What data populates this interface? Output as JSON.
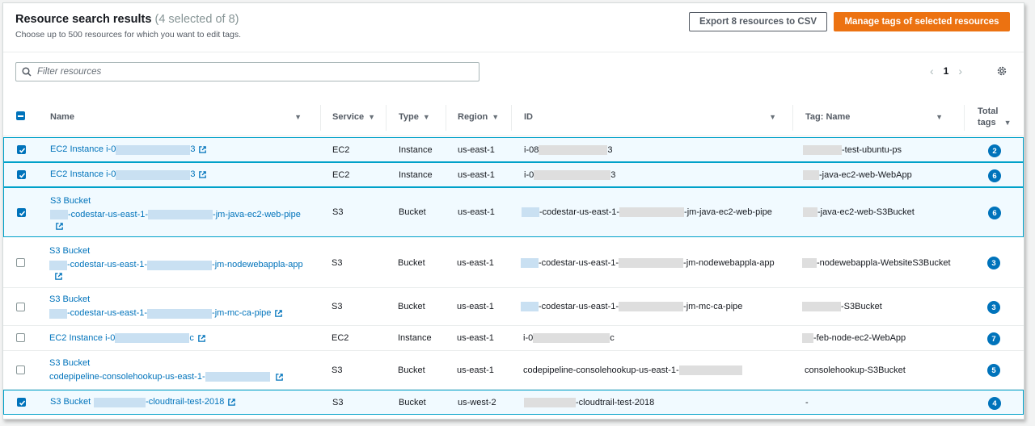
{
  "header": {
    "title": "Resource search results",
    "count": "(4 selected of 8)",
    "subtitle": "Choose up to 500 resources for which you want to edit tags."
  },
  "buttons": {
    "export": "Export 8 resources to CSV",
    "manage": "Manage tags of selected resources"
  },
  "filter": {
    "placeholder": "Filter resources"
  },
  "pagination": {
    "page": "1"
  },
  "columns": {
    "name": "Name",
    "service": "Service",
    "type": "Type",
    "region": "Region",
    "id": "ID",
    "tag_name": "Tag: Name",
    "total_tags_1": "Total",
    "total_tags_2": "tags"
  },
  "rows": [
    {
      "selected": true,
      "name": [
        "EC2 Instance i-0",
        "3"
      ],
      "service": "EC2",
      "type": "Instance",
      "region": "us-east-1",
      "id": [
        "i-08",
        "3"
      ],
      "tag": [
        "-test-ubuntu-ps"
      ],
      "total": "2"
    },
    {
      "selected": true,
      "name": [
        "EC2 Instance i-0",
        "3"
      ],
      "service": "EC2",
      "type": "Instance",
      "region": "us-east-1",
      "id": [
        "i-0",
        "3"
      ],
      "tag": [
        "-java-ec2-web-WebApp"
      ],
      "total": "6"
    },
    {
      "selected": true,
      "name_l1": "S3 Bucket",
      "name_l2": [
        "-codestar-us-east-1-",
        "-jm-java-ec2-web-pipe"
      ],
      "service": "S3",
      "type": "Bucket",
      "region": "us-east-1",
      "id": [
        "-codestar-us-east-1-",
        "-jm-java-ec2-web-pipe"
      ],
      "tag": [
        "-java-ec2-web-S3Bucket"
      ],
      "total": "6"
    },
    {
      "selected": false,
      "name_l1": "S3 Bucket",
      "name_l2": [
        "-codestar-us-east-1-",
        "-jm-nodewebappla-app"
      ],
      "service": "S3",
      "type": "Bucket",
      "region": "us-east-1",
      "id": [
        "-codestar-us-east-1-",
        "-jm-nodewebappla-app"
      ],
      "tag": [
        "-nodewebappla-WebsiteS3Bucket"
      ],
      "total": "3"
    },
    {
      "selected": false,
      "name_l1": "S3 Bucket",
      "name_l2": [
        "-codestar-us-east-1-",
        "-jm-mc-ca-pipe"
      ],
      "service": "S3",
      "type": "Bucket",
      "region": "us-east-1",
      "id": [
        "-codestar-us-east-1-",
        "-jm-mc-ca-pipe"
      ],
      "tag": [
        "-S3Bucket"
      ],
      "total": "3"
    },
    {
      "selected": false,
      "name": [
        "EC2 Instance i-0",
        "c"
      ],
      "service": "EC2",
      "type": "Instance",
      "region": "us-east-1",
      "id": [
        "i-0",
        "c"
      ],
      "tag": [
        "-feb-node-ec2-WebApp"
      ],
      "total": "7"
    },
    {
      "selected": false,
      "name_l1": "S3 Bucket",
      "name_l2": [
        "codepipeline-consolehookup-us-east-1-"
      ],
      "service": "S3",
      "type": "Bucket",
      "region": "us-east-1",
      "id": [
        "codepipeline-consolehookup-us-east-1-"
      ],
      "tag": [
        "consolehookup-S3Bucket"
      ],
      "total": "5"
    },
    {
      "selected": true,
      "name": [
        "S3 Bucket",
        "-cloudtrail-test-2018"
      ],
      "service": "S3",
      "type": "Bucket",
      "region": "us-west-2",
      "id": [
        "-cloudtrail-test-2018"
      ],
      "tag": [
        "-"
      ],
      "total": "4"
    }
  ]
}
